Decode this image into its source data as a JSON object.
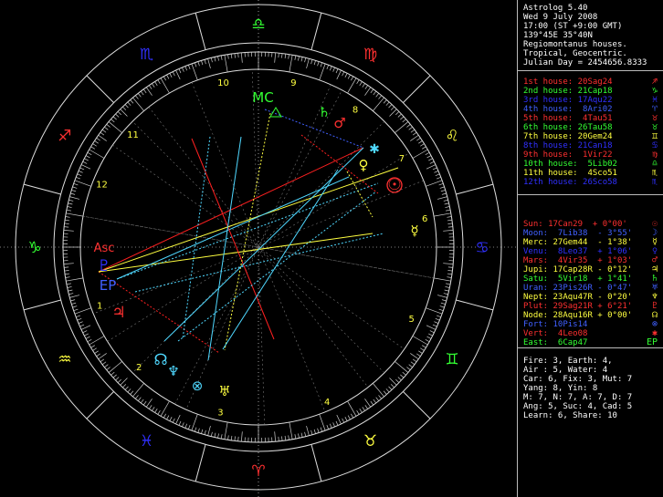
{
  "header": [
    "Astrolog 5.40",
    "Wed 9 July 2008",
    "17:00 (ST +9:00 GMT)",
    "139°45E 35°40N",
    "Regiomontanus houses.",
    "Tropical, Geocentric.",
    "Julian Day = 2454656.8333"
  ],
  "houses": [
    {
      "text": "1st house: 20Sag24",
      "color": "#ff3030",
      "sym": "♐"
    },
    {
      "text": "2nd house: 21Cap18",
      "color": "#33ff33",
      "sym": "♑"
    },
    {
      "text": "3rd house: 17Aqu22",
      "color": "#3030ff",
      "sym": "♓"
    },
    {
      "text": "4th house:  8Ari02",
      "color": "#4060ff",
      "sym": "♈"
    },
    {
      "text": "5th house:  4Tau51",
      "color": "#ff3030",
      "sym": "♉"
    },
    {
      "text": "6th house: 26Tau58",
      "color": "#33ff33",
      "sym": "♉"
    },
    {
      "text": "7th house: 20Gem24",
      "color": "#ffff40",
      "sym": "♊"
    },
    {
      "text": "8th house: 21Can18",
      "color": "#3030ff",
      "sym": "♋"
    },
    {
      "text": "9th house:  1Vir22",
      "color": "#ff3030",
      "sym": "♍"
    },
    {
      "text": "10th house:  5Lib02",
      "color": "#33ff33",
      "sym": "♎"
    },
    {
      "text": "11th house:  4Sco51",
      "color": "#ffff40",
      "sym": "♏"
    },
    {
      "text": "12th house: 26Sco58",
      "color": "#3030ff",
      "sym": "♏"
    }
  ],
  "planets": [
    {
      "text": "Sun: 17Can29  + 0°00'",
      "color": "#ff3030",
      "sym": "☉"
    },
    {
      "text": "Moon:  7Lib38  - 3°55'",
      "color": "#4060ff",
      "sym": "☽"
    },
    {
      "text": "Merc: 27Gem44  - 1°38'",
      "color": "#ffff40",
      "sym": "☿"
    },
    {
      "text": "Venu:  8Leo37  + 1°06'",
      "color": "#3030ff",
      "sym": "♀"
    },
    {
      "text": "Mars:  4Vir35  + 1°03'",
      "color": "#ff3030",
      "sym": "♂"
    },
    {
      "text": "Jupi: 17Cap28R - 0°12'",
      "color": "#ffff40",
      "sym": "♃"
    },
    {
      "text": "Satu:  5Vir18  + 1°41'",
      "color": "#33ff33",
      "sym": "♄"
    },
    {
      "text": "Uran: 23Pis26R - 0°47'",
      "color": "#4060ff",
      "sym": "♅"
    },
    {
      "text": "Nept: 23Aqu47R - 0°20'",
      "color": "#ffff40",
      "sym": "♆"
    },
    {
      "text": "Plut: 29Sag21R + 6°21'",
      "color": "#ff3030",
      "sym": "♇"
    },
    {
      "text": "Node: 28Aqu16R + 0°00'",
      "color": "#ffff40",
      "sym": "☊"
    },
    {
      "text": "Fort: 10Pis14",
      "color": "#4060ff",
      "sym": "⊗"
    },
    {
      "text": "Vert:  4Leo08",
      "color": "#ff3030",
      "sym": "✱"
    },
    {
      "text": "East:  6Cap47",
      "color": "#33ff33",
      "sym": "EP"
    }
  ],
  "stats": [
    "Fire: 3, Earth: 4,",
    "Air : 5, Water: 4",
    "Car: 6, Fix: 3, Mut: 7",
    "Yang: 8, Yin: 8",
    "M: 7, N: 7, A: 7, D: 7",
    "Ang: 5, Suc: 4, Cad: 5",
    "Learn: 6, Share: 10"
  ],
  "zodiac_signs": [
    {
      "glyph": "♎",
      "color": "#33ff33"
    },
    {
      "glyph": "♍",
      "color": "#ff3030"
    },
    {
      "glyph": "♌",
      "color": "#ffff40"
    },
    {
      "glyph": "♋",
      "color": "#3030ff"
    },
    {
      "glyph": "♊",
      "color": "#33ff33"
    },
    {
      "glyph": "♉",
      "color": "#ffff40"
    },
    {
      "glyph": "♈",
      "color": "#ff3030"
    },
    {
      "glyph": "♓",
      "color": "#3030ff"
    },
    {
      "glyph": "♒",
      "color": "#ffff40"
    },
    {
      "glyph": "♑",
      "color": "#33ff33"
    },
    {
      "glyph": "♐",
      "color": "#ff3030"
    },
    {
      "glyph": "♏",
      "color": "#3030ff"
    }
  ],
  "house_numbers": [
    "10",
    "9",
    "8",
    "7",
    "6",
    "5",
    "4",
    "3",
    "2",
    "1",
    "12",
    "11"
  ],
  "chart_labels": {
    "mc": "MC",
    "asc": "Asc",
    "ep": "EP"
  }
}
